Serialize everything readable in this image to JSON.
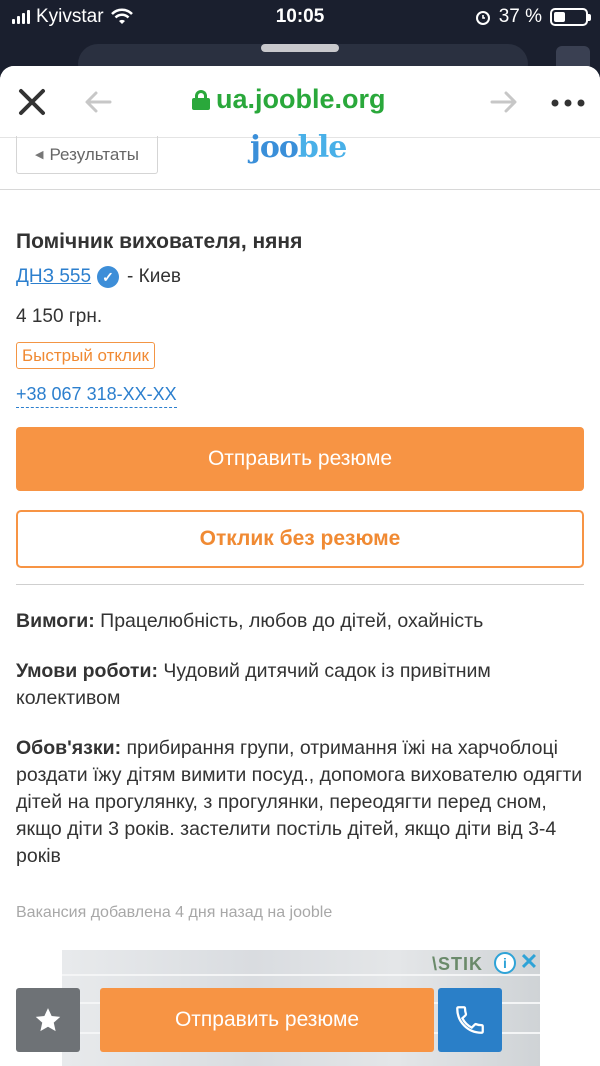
{
  "status_bar": {
    "carrier": "Kyivstar",
    "time": "10:05",
    "battery_percent": "37 %",
    "battery_level": 0.37
  },
  "browser": {
    "url": "ua.jooble.org",
    "close_icon": "close-icon",
    "back_icon": "arrow-left-icon",
    "forward_icon": "arrow-right-icon",
    "more_icon": "more-icon"
  },
  "site": {
    "results_label": "Результаты",
    "logo_text": "jooble"
  },
  "job": {
    "title": "Помічник вихователя, няня",
    "company": "ДНЗ 555",
    "location": "- Киев",
    "salary": "4 150 грн.",
    "quick_apply_badge": "Быстрый отклик",
    "phone": "+38 067 318-XX-XX",
    "apply_button": "Отправить резюме",
    "apply_without_resume_button": "Отклик без резюме",
    "requirements_label": "Вимоги:",
    "requirements_text": " Працелюбність, любов до дітей, охайність",
    "conditions_label": "Умови роботи:",
    "conditions_text": " Чудовий дитячий садок із привітним колективом",
    "duties_label": "Обов'язки:",
    "duties_text": " прибирання групи, отримання їжі на харчоблоці роздати їжу дітям вимити посуд., допомога вихователю одягти дітей на прогулянку, з прогулянки, переодягти перед сном, якщо діти 3 років. застелити постіль дітей, якщо діти від 3-4 років",
    "posted": "Вакансия добавлена 4 дня назад на jooble"
  },
  "ad": {
    "partial_text": "\\STIK"
  },
  "bottom_bar": {
    "apply_button": "Отправить резюме",
    "fav_icon": "star-icon",
    "call_icon": "phone-icon"
  },
  "colors": {
    "accent_orange": "#f79444",
    "link_blue": "#2c7fce",
    "secure_green": "#2aa83b"
  }
}
